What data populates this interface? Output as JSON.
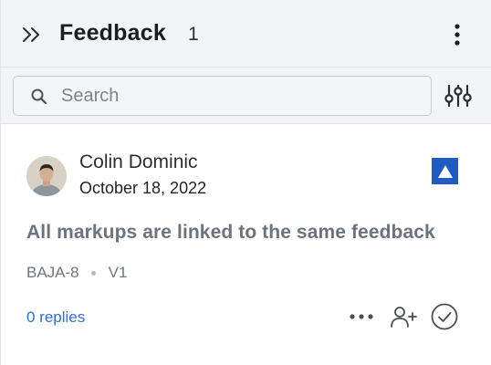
{
  "header": {
    "title": "Feedback",
    "count": "1",
    "collapse_icon": "double-chevron-right-icon",
    "menu_icon": "vertical-ellipsis-icon"
  },
  "search": {
    "placeholder": "Search",
    "value": "",
    "filter_icon": "sliders-icon"
  },
  "feedback_items": [
    {
      "author": "Colin Dominic",
      "date": "October 18, 2022",
      "markup_type_icon": "triangle-markup-icon",
      "text": "All markups are linked to the same feedback",
      "reference": "BAJA-8",
      "version": "V1",
      "replies_label": "0 replies",
      "actions": [
        "more-icon",
        "add-person-icon",
        "resolve-check-icon"
      ]
    }
  ],
  "colors": {
    "accent_blue": "#1f5bc1",
    "link_blue": "#2b6fd6",
    "header_bg": "#f3f4f6"
  }
}
